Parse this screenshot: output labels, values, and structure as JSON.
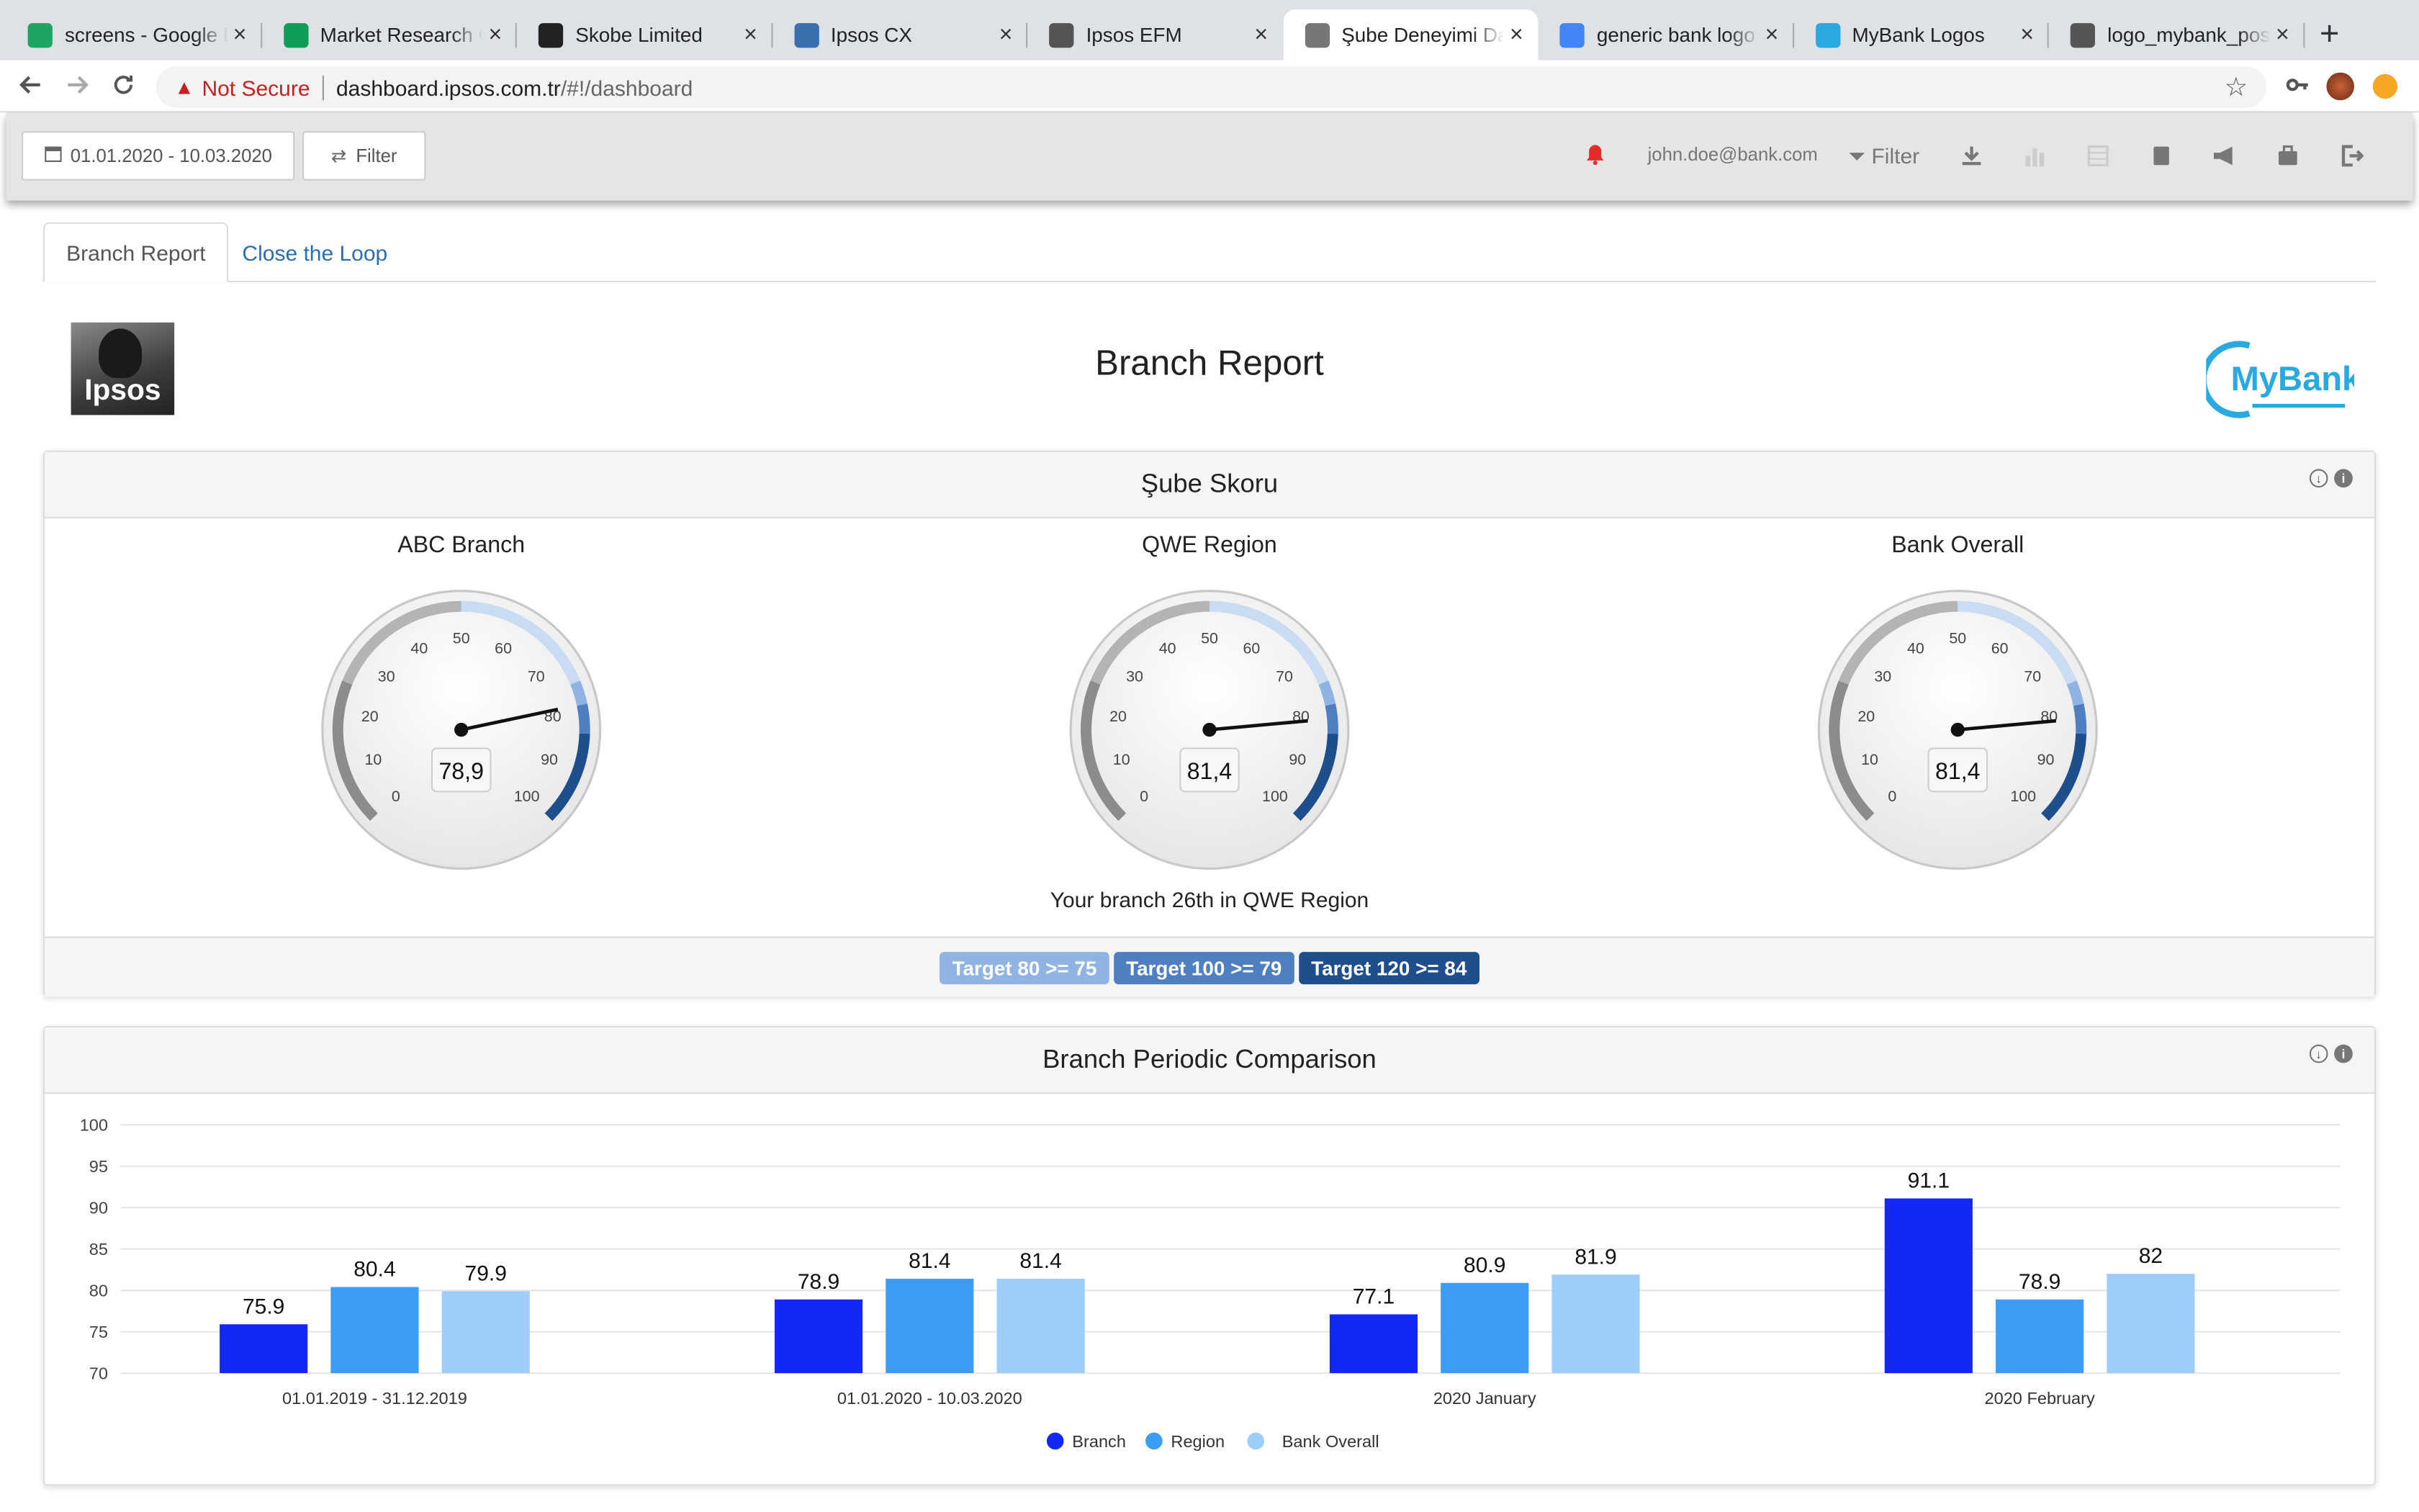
{
  "browser": {
    "tabs": [
      {
        "title": "screens - Google Dr",
        "favicon": "google-drive-icon",
        "color": "#1fa463"
      },
      {
        "title": "Market Research Co",
        "favicon": "google-sheets-icon",
        "color": "#0f9d58"
      },
      {
        "title": "Skobe Limited",
        "favicon": "chat-bubble-icon",
        "color": "#222222"
      },
      {
        "title": "Ipsos CX",
        "favicon": "ipsos-icon",
        "color": "#3a6fb0"
      },
      {
        "title": "Ipsos EFM",
        "favicon": "globe-icon",
        "color": "#555555"
      },
      {
        "title": "Şube Deneyimi Das",
        "favicon": "binoculars-icon",
        "color": "#777777"
      },
      {
        "title": "generic bank logo -",
        "favicon": "google-g-icon",
        "color": "#4285f4"
      },
      {
        "title": "MyBank Logos",
        "favicon": "mybank-icon",
        "color": "#29a9e0"
      },
      {
        "title": "logo_mybank_positi",
        "favicon": "globe-icon",
        "color": "#555555"
      }
    ],
    "active_tab_index": 5,
    "security_label": "Not Secure",
    "url_host": "dashboard.ipsos.com.tr",
    "url_path": "/#!/dashboard"
  },
  "toolbar": {
    "date_range": "01.01.2020 - 10.03.2020",
    "filter_label": "Filter",
    "user_email": "john.doe@bank.com",
    "filter_right_label": "Filter"
  },
  "page": {
    "tabs": [
      "Branch Report",
      "Close the Loop"
    ],
    "title": "Branch Report",
    "ipsos_logo_text": "Ipsos",
    "mybank_logo_text": "MyBank"
  },
  "score_panel": {
    "title": "Şube Skoru",
    "gauges": [
      {
        "label": "ABC Branch",
        "value": 78.9,
        "display": "78,9"
      },
      {
        "label": "QWE Region",
        "value": 81.4,
        "display": "81,4"
      },
      {
        "label": "Bank Overall",
        "value": 81.4,
        "display": "81,4"
      }
    ],
    "gauge_ticks": [
      "0",
      "10",
      "20",
      "30",
      "40",
      "50",
      "60",
      "70",
      "80",
      "90",
      "100"
    ],
    "rank_text": "Your branch 26th in QWE Region",
    "targets": [
      {
        "label": "Target 80 >= 75",
        "color": "#8fb4e3"
      },
      {
        "label": "Target 100 >= 79",
        "color": "#4f7fc0"
      },
      {
        "label": "Target 120 >= 84",
        "color": "#1f4e8c"
      }
    ]
  },
  "comparison_panel": {
    "title": "Branch Periodic Comparison"
  },
  "chart_data": {
    "type": "bar",
    "categories": [
      "01.01.2019 - 31.12.2019",
      "01.01.2020 - 10.03.2020",
      "2020 January",
      "2020 February"
    ],
    "series": [
      {
        "name": "Branch",
        "values": [
          75.9,
          78.9,
          77.1,
          91.1
        ],
        "labels": [
          "75.9",
          "78.9",
          "77.1",
          "91.1"
        ],
        "color": "#1428f5"
      },
      {
        "name": "Region",
        "values": [
          80.4,
          81.4,
          80.9,
          78.9
        ],
        "labels": [
          "80.4",
          "81.4",
          "80.9",
          "78.9"
        ],
        "color": "#3d9df5"
      },
      {
        "name": "Bank Overall",
        "values": [
          79.9,
          81.4,
          81.9,
          82
        ],
        "labels": [
          "79.9",
          "81.4",
          "81.9",
          "82"
        ],
        "color": "#9ecdfa"
      }
    ],
    "yticks": [
      "70",
      "75",
      "80",
      "85",
      "90",
      "95",
      "100"
    ],
    "ylim": [
      70,
      100
    ],
    "grid": true,
    "legend": "bottom-center"
  }
}
